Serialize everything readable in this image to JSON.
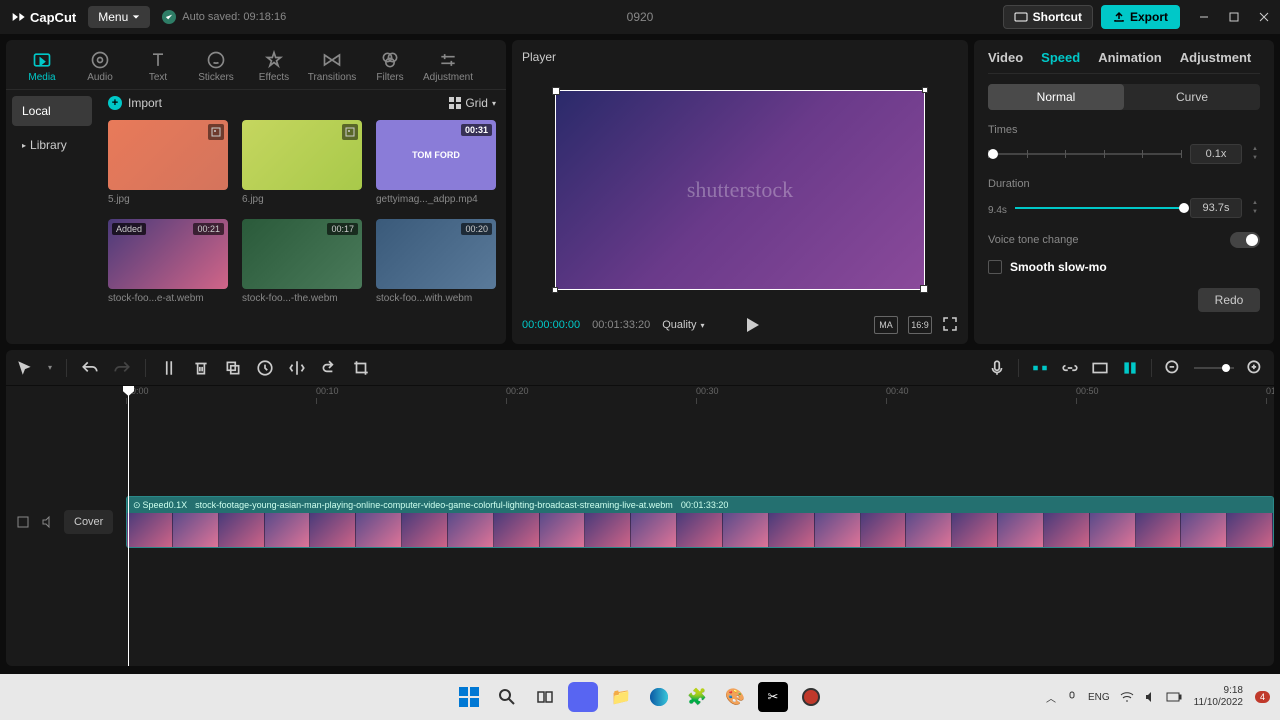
{
  "app": {
    "name": "CapCut",
    "title": "0920"
  },
  "topbar": {
    "menu": "Menu",
    "auto_saved": "Auto saved: 09:18:16",
    "shortcut": "Shortcut",
    "export": "Export"
  },
  "tools": [
    {
      "id": "media",
      "label": "Media",
      "active": true
    },
    {
      "id": "audio",
      "label": "Audio"
    },
    {
      "id": "text",
      "label": "Text"
    },
    {
      "id": "stickers",
      "label": "Stickers"
    },
    {
      "id": "effects",
      "label": "Effects"
    },
    {
      "id": "transitions",
      "label": "Transitions"
    },
    {
      "id": "filters",
      "label": "Filters"
    },
    {
      "id": "adjustment",
      "label": "Adjustment"
    }
  ],
  "side_nav": {
    "local": "Local",
    "library": "Library"
  },
  "media": {
    "import": "Import",
    "grid": "Grid",
    "items": [
      {
        "name": "5.jpg",
        "type": "image"
      },
      {
        "name": "6.jpg",
        "type": "image"
      },
      {
        "name": "gettyimag..._adpp.mp4",
        "duration": "00:31",
        "thumb_text": "TOM FORD"
      },
      {
        "name": "stock-foo...e-at.webm",
        "duration": "00:21",
        "added": "Added"
      },
      {
        "name": "stock-foo...-the.webm",
        "duration": "00:17"
      },
      {
        "name": "stock-foo...with.webm",
        "duration": "00:20"
      }
    ]
  },
  "player": {
    "title": "Player",
    "watermark": "shutterstock",
    "tc_current": "00:00:00:00",
    "tc_total": "00:01:33:20",
    "quality": "Quality",
    "ratio": "16:9",
    "original": "MA"
  },
  "props": {
    "tabs": [
      "Video",
      "Speed",
      "Animation",
      "Adjustment"
    ],
    "active_tab": "Speed",
    "sub_tabs": {
      "normal": "Normal",
      "curve": "Curve"
    },
    "times_label": "Times",
    "times_value": "0.1x",
    "duration_label": "Duration",
    "duration_original": "9.4s",
    "duration_value": "93.7s",
    "voice_change": "Voice tone change",
    "smooth": "Smooth slow-mo",
    "redo": "Redo"
  },
  "timeline": {
    "ruler": [
      "00:00",
      "00:10",
      "00:20",
      "00:30",
      "00:40",
      "00:50",
      "01"
    ],
    "cover": "Cover",
    "clip": {
      "speed_tag": "Speed0.1X",
      "name": "stock-footage-young-asian-man-playing-online-computer-video-game-colorful-lighting-broadcast-streaming-live-at.webm",
      "duration": "00:01:33:20"
    }
  },
  "taskbar": {
    "time": "9:18",
    "date": "11/10/2022",
    "notif": "4"
  }
}
